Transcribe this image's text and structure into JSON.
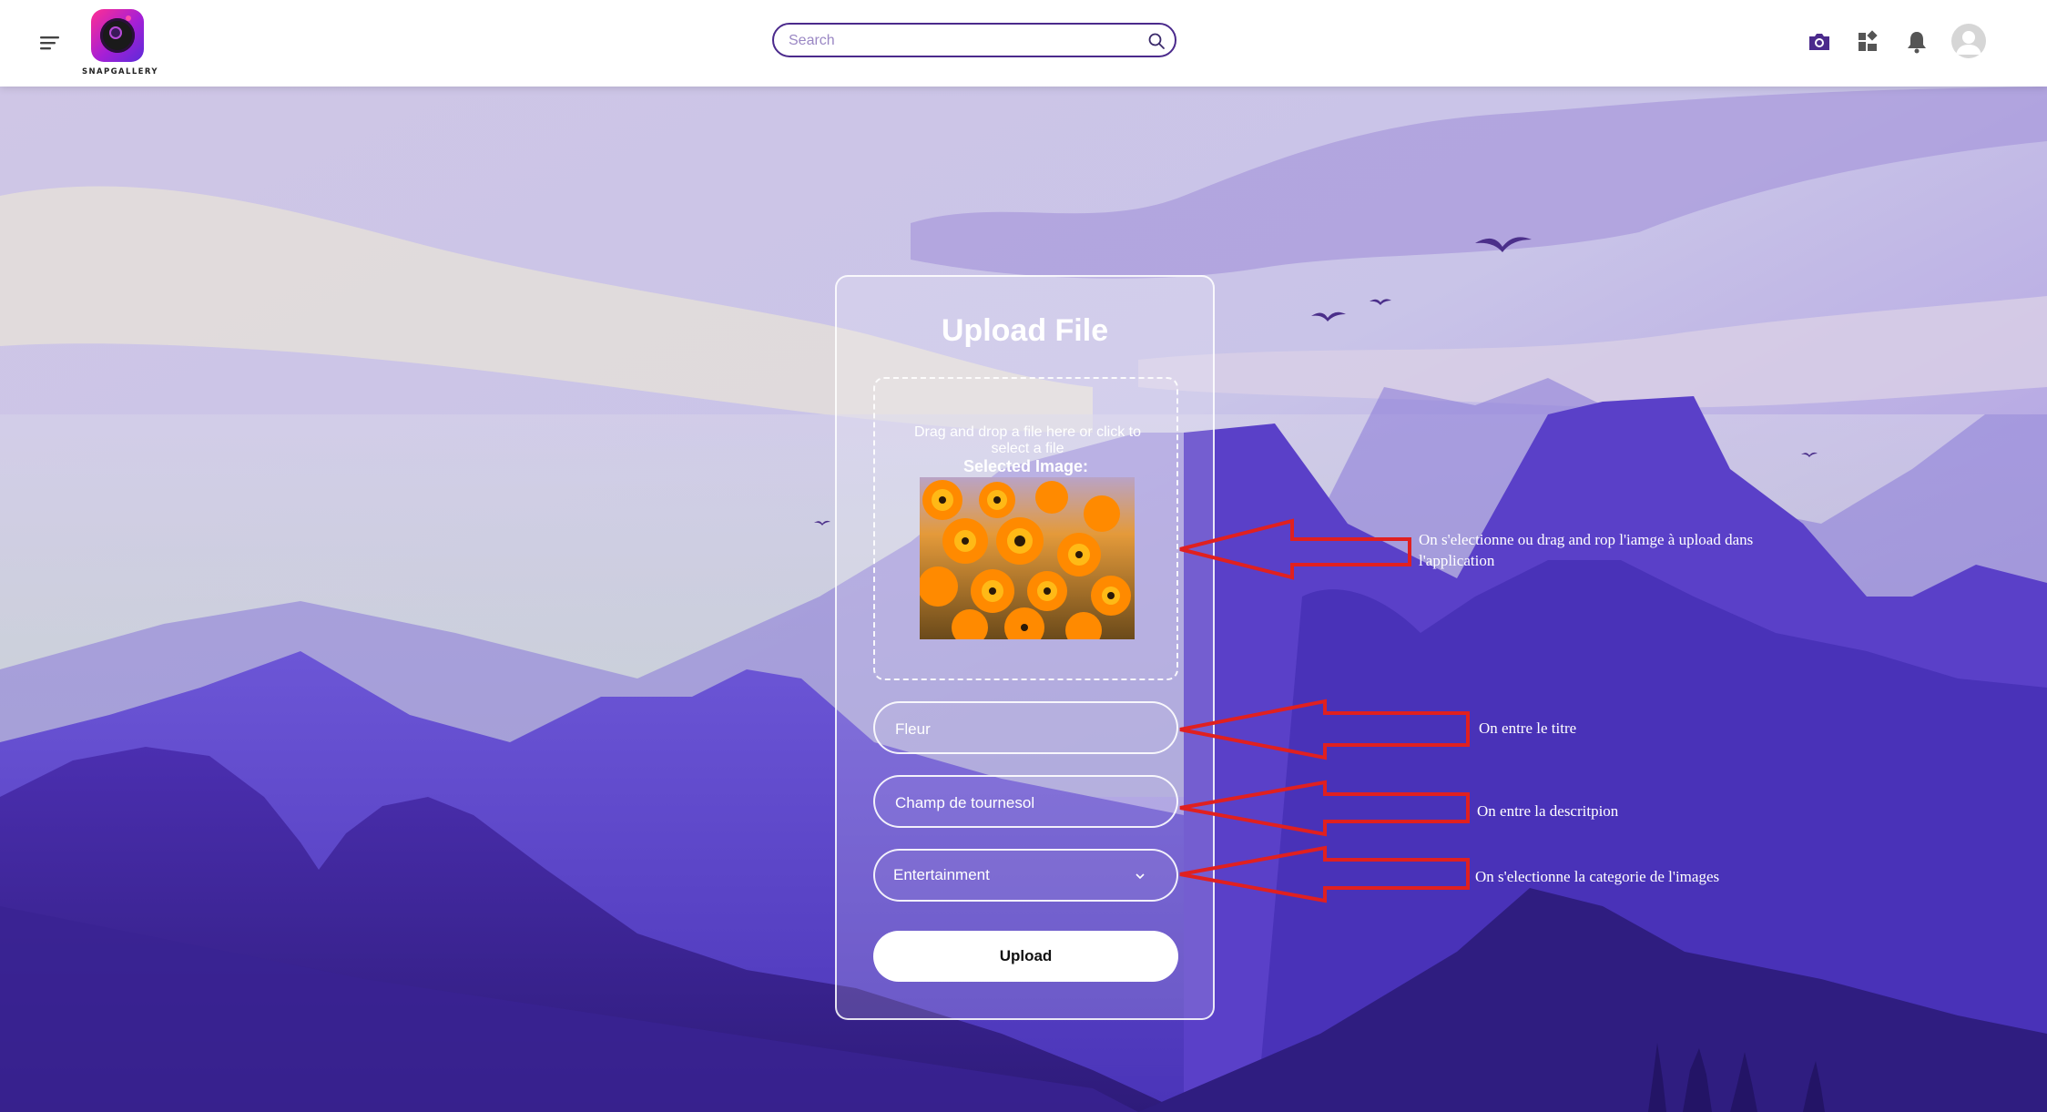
{
  "header": {
    "logo_text": "SNAPGALLERY",
    "search_placeholder": "Search",
    "icons": [
      "menu-icon",
      "search-icon",
      "camera-icon",
      "dashboard-icon",
      "bell-icon",
      "avatar-icon"
    ]
  },
  "card": {
    "title": "Upload File",
    "dropzone_text": "Drag and drop a file here or click to select a file",
    "selected_label": "Selected Image:",
    "title_value": "Fleur",
    "description_value": "Champ de tournesol",
    "category_value": "Entertainment",
    "upload_label": "Upload"
  },
  "annotations": {
    "image": "On s'electionne ou drag and rop l'iamge à upload dans l'application",
    "title": "On entre le titre",
    "description": "On entre la descritpion",
    "category": "On s'electionne la categorie de l'images"
  },
  "colors": {
    "accent": "#4b2a8c",
    "arrow": "#e02020",
    "card_border": "#ffffff"
  }
}
